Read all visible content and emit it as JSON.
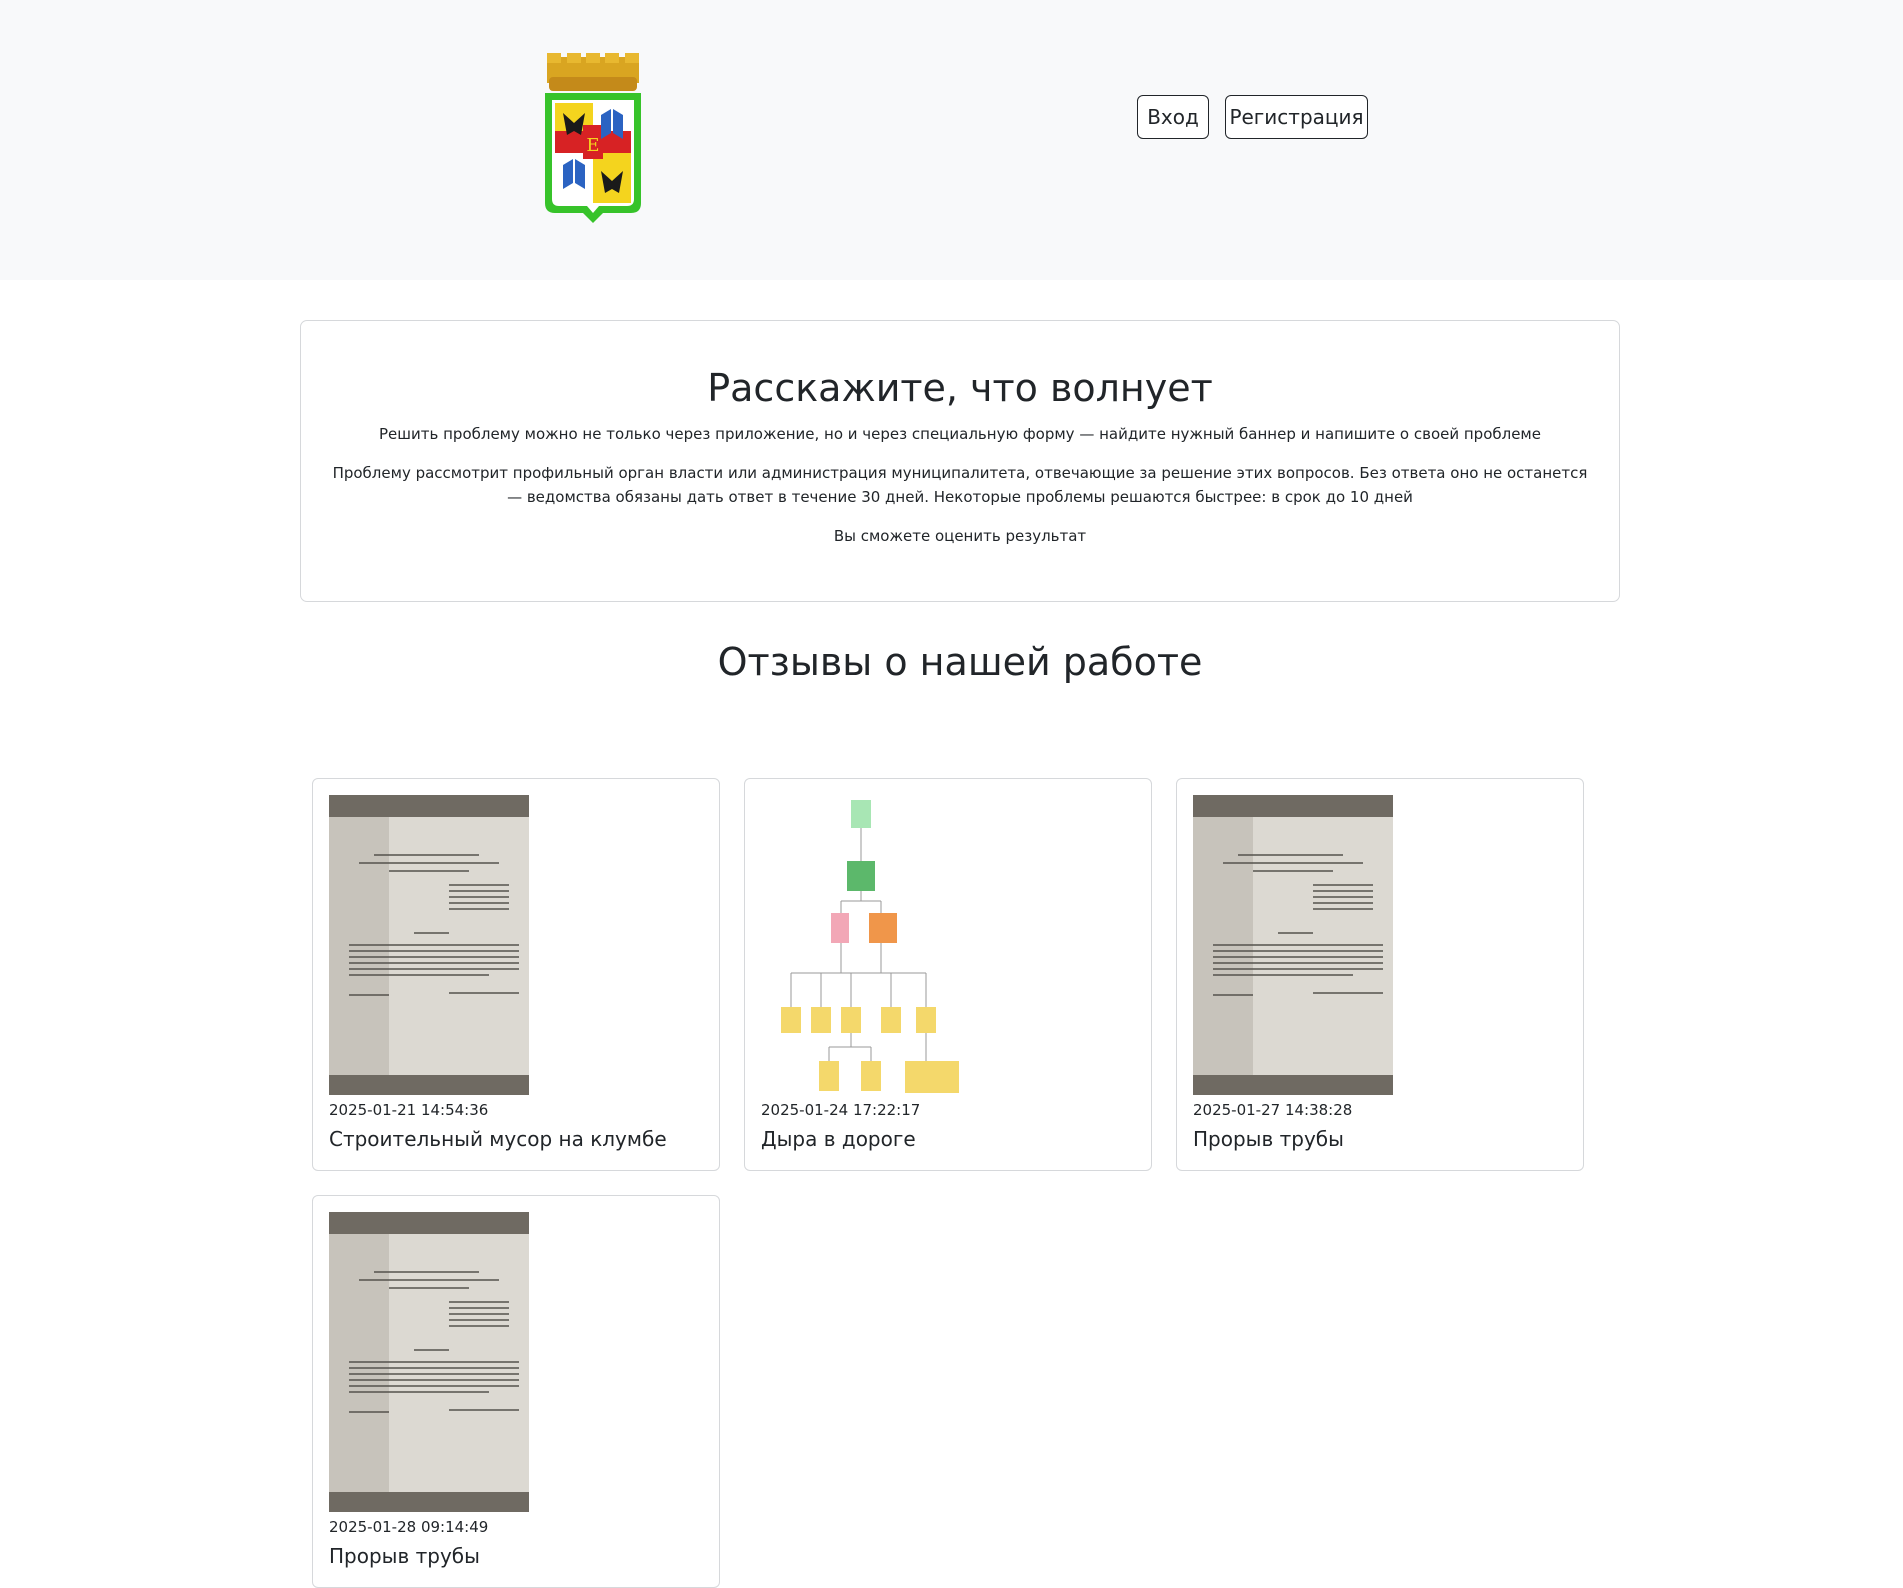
{
  "header": {
    "login_label": "Вход",
    "register_label": "Регистрация",
    "logo_icon": "city-coat-of-arms-icon"
  },
  "info": {
    "title": "Расскажите, что волнует",
    "paragraph1": "Решить проблему можно не только через приложение, но и через специальную форму — найдите нужный баннер и напишите о своей проблеме",
    "paragraph2": "Проблему рассмотрит профильный орган власти или администрация муниципалитета, отвечающие за решение этих вопросов. Без ответа оно не останется — ведомства обязаны дать ответ в течение 30 дней. Некоторые проблемы решаются быстрее: в срок до 10 дней",
    "paragraph3": "Вы сможете оценить результат"
  },
  "reviews": {
    "title": "Отзывы о нашей работе",
    "items": [
      {
        "date": "2025-01-21 14:54:36",
        "title": "Строительный мусор на клумбе",
        "image": "document-photo"
      },
      {
        "date": "2025-01-24 17:22:17",
        "title": "Дыра в дороге",
        "image": "flowchart-diagram"
      },
      {
        "date": "2025-01-27 14:38:28",
        "title": "Прорыв трубы",
        "image": "document-photo"
      },
      {
        "date": "2025-01-28 09:14:49",
        "title": "Прорыв трубы",
        "image": "document-photo"
      }
    ]
  },
  "colors": {
    "header_bg": "#f8f9fa",
    "border": "#d6d8db",
    "text": "#212529"
  }
}
